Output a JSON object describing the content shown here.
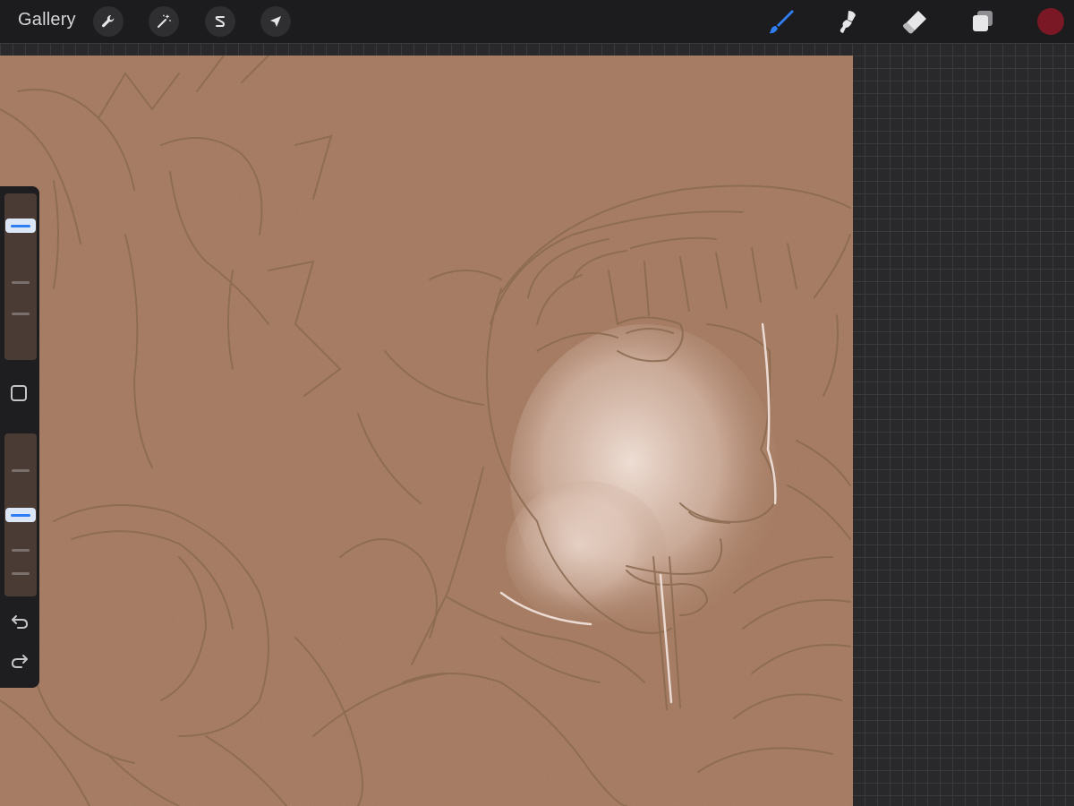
{
  "topbar": {
    "gallery_label": "Gallery",
    "left_tools": [
      {
        "name": "actions",
        "icon": "wrench-icon"
      },
      {
        "name": "adjustments",
        "icon": "magic-wand-icon"
      },
      {
        "name": "selection",
        "icon": "selection-s-icon"
      },
      {
        "name": "transform",
        "icon": "arrow-cursor-icon"
      }
    ],
    "right_tools": [
      {
        "name": "brush",
        "icon": "brush-icon",
        "active": true
      },
      {
        "name": "smudge",
        "icon": "smudge-icon",
        "active": false
      },
      {
        "name": "eraser",
        "icon": "eraser-icon",
        "active": false
      },
      {
        "name": "layers",
        "icon": "layers-icon",
        "active": false
      }
    ],
    "current_color": "#7a1826",
    "active_tool_color": "#2f7ef3"
  },
  "sidebar": {
    "brush_size_level": 0.85,
    "opacity_level": 0.5,
    "modify_button_icon": "square-icon",
    "undo_icon": "undo-icon",
    "redo_icon": "redo-icon"
  },
  "canvas": {
    "paper_color": "#a57b62",
    "sketch_line_color": "#8a6a50",
    "highlight_color": "#f2e4dc"
  }
}
